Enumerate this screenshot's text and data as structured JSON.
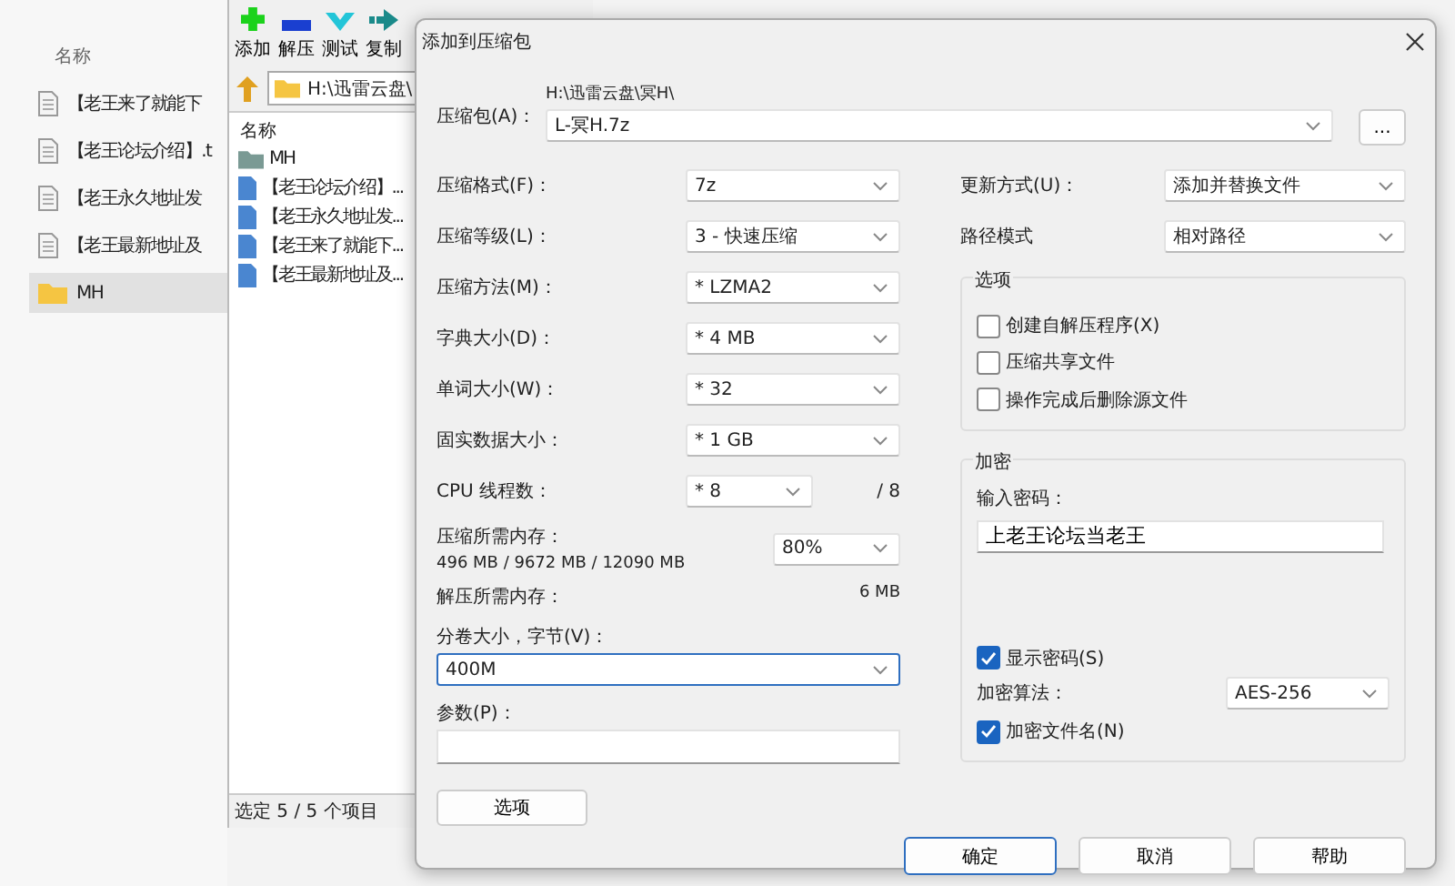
{
  "explorer": {
    "column_header": "名称",
    "items": [
      {
        "name": "【老王来了就能下",
        "kind": "file",
        "selected": false
      },
      {
        "name": "【老王论坛介绍】.t",
        "kind": "file",
        "selected": false
      },
      {
        "name": "【老王永久地址发",
        "kind": "file",
        "selected": false
      },
      {
        "name": "【老王最新地址及",
        "kind": "file",
        "selected": false
      },
      {
        "name": "MH",
        "kind": "folder",
        "selected": true
      }
    ]
  },
  "archiver": {
    "toolbar": [
      {
        "label": "添加",
        "kind": "add"
      },
      {
        "label": "解压",
        "kind": "extract"
      },
      {
        "label": "测试",
        "kind": "test"
      },
      {
        "label": "复制",
        "kind": "copy"
      }
    ],
    "path": "H:\\迅雷云盘\\",
    "column_header": "名称",
    "items": [
      {
        "name": "MH",
        "kind": "folder"
      },
      {
        "name": "【老王论坛介绍】...",
        "kind": "file"
      },
      {
        "name": "【老王永久地址发...",
        "kind": "file"
      },
      {
        "name": "【老王来了就能下...",
        "kind": "file"
      },
      {
        "name": "【老王最新地址及...",
        "kind": "file"
      }
    ],
    "status_bar": "选定 5 / 5 个项目"
  },
  "dialog": {
    "title": "添加到压缩包",
    "archive": {
      "label": "压缩包(A)：",
      "folder": "H:\\迅雷云盘\\冥H\\",
      "value": "L-冥H.7z",
      "browse": "..."
    },
    "settings": [
      {
        "label": "压缩格式(F)：",
        "value": "7z"
      },
      {
        "label": "压缩等级(L)：",
        "value": "3 - 快速压缩"
      },
      {
        "label": "压缩方法(M)：",
        "value": "* LZMA2"
      },
      {
        "label": "字典大小(D)：",
        "value": "* 4 MB"
      },
      {
        "label": "单词大小(W)：",
        "value": "* 32"
      },
      {
        "label": "固实数据大小：",
        "value": "* 1 GB"
      },
      {
        "label": "CPU 线程数：",
        "value": "* 8",
        "suffix": "/ 8"
      }
    ],
    "memory": {
      "label": "压缩所需内存：",
      "value": "496 MB / 9672 MB / 12090 MB",
      "limit": "80%"
    },
    "decompress": {
      "label": "解压所需内存：",
      "value": "6 MB"
    },
    "split": {
      "label": "分卷大小，字节(V)：",
      "value": "400M"
    },
    "params": {
      "label": "参数(P)："
    },
    "options_button": "选项",
    "update": {
      "label": "更新方式(U)：",
      "value": "添加并替换文件"
    },
    "path_mode": {
      "label": "路径模式",
      "value": "相对路径"
    },
    "options": {
      "title": "选项",
      "items": [
        {
          "label": "创建自解压程序(X)",
          "checked": false
        },
        {
          "label": "压缩共享文件",
          "checked": false
        },
        {
          "label": "操作完成后删除源文件",
          "checked": false
        }
      ]
    },
    "encryption": {
      "title": "加密",
      "password_label": "输入密码：",
      "password": "上老王论坛当老王",
      "show_password": {
        "label": "显示密码(S)",
        "checked": true
      },
      "method_label": "加密算法：",
      "method": "AES-256",
      "encrypt_names": {
        "label": "加密文件名(N)",
        "checked": true
      }
    },
    "buttons": [
      {
        "label": "确定",
        "default": true
      },
      {
        "label": "取消",
        "default": false
      },
      {
        "label": "帮助",
        "default": false
      }
    ]
  }
}
